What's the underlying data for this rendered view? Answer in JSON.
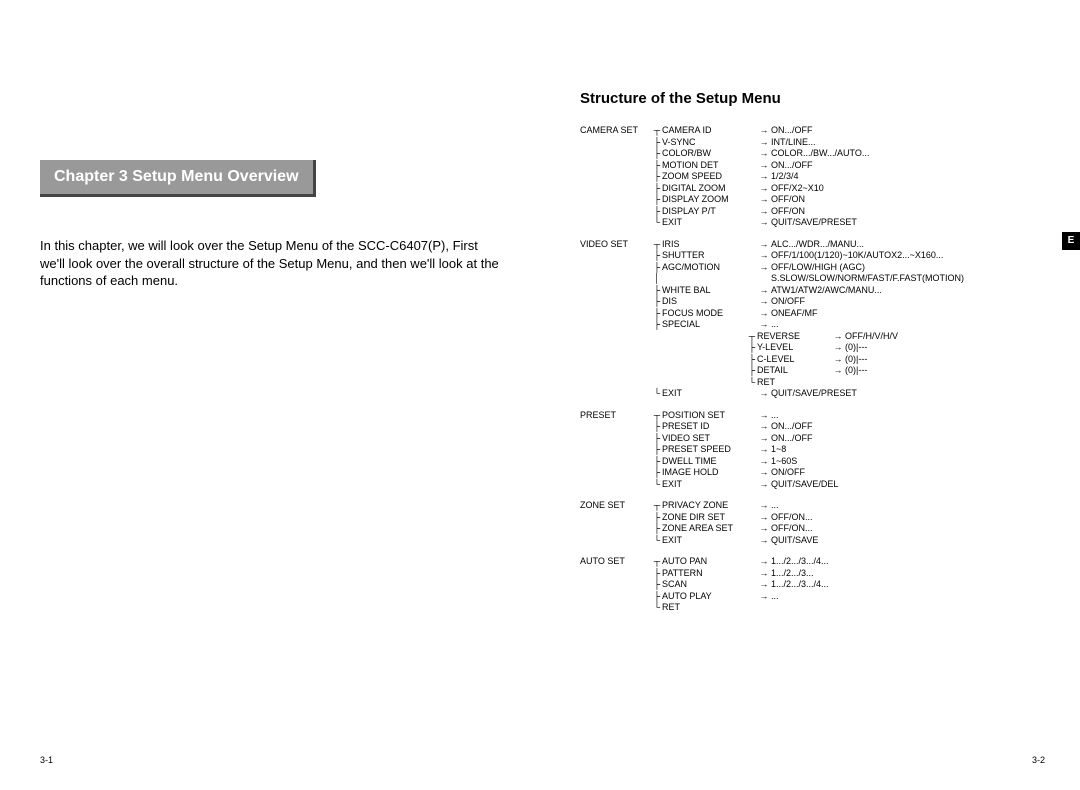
{
  "left": {
    "chapter_banner": "Chapter 3  Setup Menu Overview",
    "intro": "In this chapter, we will look over the Setup Menu of the SCC-C6407(P), First we'll look over the overall structure of the Setup Menu, and then we'll look at the functions of each menu.",
    "page_num": "3-1"
  },
  "right": {
    "heading": "Structure of the Setup Menu",
    "etab": "E",
    "page_num": "3-2",
    "menu": {
      "camera_set": {
        "label": "CAMERA SET",
        "items": [
          {
            "name": "CAMERA ID",
            "val": "ON.../OFF"
          },
          {
            "name": "V-SYNC",
            "val": "INT/LINE..."
          },
          {
            "name": "COLOR/BW",
            "val": "COLOR.../BW.../AUTO..."
          },
          {
            "name": "MOTION DET",
            "val": "ON.../OFF"
          },
          {
            "name": "ZOOM SPEED",
            "val": "1/2/3/4"
          },
          {
            "name": "DIGITAL ZOOM",
            "val": "OFF/X2~X10"
          },
          {
            "name": "DISPLAY ZOOM",
            "val": "OFF/ON"
          },
          {
            "name": "DISPLAY P/T",
            "val": "OFF/ON"
          },
          {
            "name": "EXIT",
            "val": "QUIT/SAVE/PRESET"
          }
        ]
      },
      "video_set": {
        "label": "VIDEO SET",
        "items": [
          {
            "name": "IRIS",
            "val": "ALC.../WDR.../MANU..."
          },
          {
            "name": "SHUTTER",
            "val": "OFF/1/100(1/120)~10K/AUTOX2...~X160..."
          },
          {
            "name": "AGC/MOTION",
            "val": "OFF/LOW/HIGH (AGC)"
          },
          {
            "name": "",
            "val": "S.SLOW/SLOW/NORM/FAST/F.FAST(MOTION)"
          },
          {
            "name": "WHITE BAL",
            "val": "ATW1/ATW2/AWC/MANU..."
          },
          {
            "name": "DIS",
            "val": "ON/OFF"
          },
          {
            "name": "FOCUS MODE",
            "val": "ONEAF/MF"
          },
          {
            "name": "SPECIAL",
            "val": "..."
          }
        ],
        "special_sub": [
          {
            "name": "REVERSE",
            "val": "OFF/H/V/H/V"
          },
          {
            "name": "Y-LEVEL",
            "val": "(0)|---"
          },
          {
            "name": "C-LEVEL",
            "val": "(0)|---"
          },
          {
            "name": "DETAIL",
            "val": "(0)|---"
          },
          {
            "name": "RET",
            "val": ""
          }
        ],
        "exit": {
          "name": "EXIT",
          "val": "QUIT/SAVE/PRESET"
        }
      },
      "preset": {
        "label": "PRESET",
        "items": [
          {
            "name": "POSITION SET",
            "val": "..."
          },
          {
            "name": "PRESET ID",
            "val": "ON.../OFF"
          },
          {
            "name": "VIDEO SET",
            "val": "ON.../OFF"
          },
          {
            "name": "PRESET SPEED",
            "val": "1~8"
          },
          {
            "name": "DWELL TIME",
            "val": "1~60S"
          },
          {
            "name": "IMAGE HOLD",
            "val": "ON/OFF"
          },
          {
            "name": "EXIT",
            "val": "QUIT/SAVE/DEL"
          }
        ]
      },
      "zone_set": {
        "label": "ZONE SET",
        "items": [
          {
            "name": "PRIVACY ZONE",
            "val": "..."
          },
          {
            "name": "ZONE DIR SET",
            "val": "OFF/ON..."
          },
          {
            "name": "ZONE AREA SET",
            "val": "OFF/ON..."
          },
          {
            "name": "EXIT",
            "val": "QUIT/SAVE"
          }
        ]
      },
      "auto_set": {
        "label": "AUTO SET",
        "items": [
          {
            "name": "AUTO PAN",
            "val": "1.../2.../3.../4..."
          },
          {
            "name": "PATTERN",
            "val": "1.../2.../3..."
          },
          {
            "name": "SCAN",
            "val": "1.../2.../3.../4..."
          },
          {
            "name": "AUTO PLAY",
            "val": "..."
          },
          {
            "name": "RET",
            "val": ""
          }
        ]
      }
    }
  }
}
